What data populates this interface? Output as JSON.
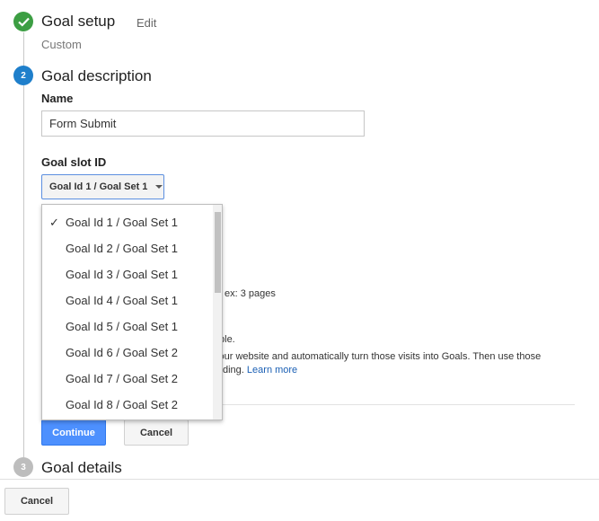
{
  "steps": {
    "setup": {
      "title": "Goal setup",
      "edit_label": "Edit",
      "summary": "Custom"
    },
    "description": {
      "number": "2",
      "title": "Goal description"
    },
    "details": {
      "number": "3",
      "title": "Goal details"
    }
  },
  "form": {
    "name_label": "Name",
    "name_value": "Form Submit",
    "goal_slot_label": "Goal slot ID",
    "goal_slot_selected": "Goal Id 1 / Goal Set 1"
  },
  "dropdown": {
    "check_glyph": "✓",
    "items": [
      {
        "label": "Goal Id 1 / Goal Set 1"
      },
      {
        "label": "Goal Id 2 / Goal Set 1"
      },
      {
        "label": "Goal Id 3 / Goal Set 1"
      },
      {
        "label": "Goal Id 4 / Goal Set 1"
      },
      {
        "label": "Goal Id 5 / Goal Set 1"
      },
      {
        "label": "Goal Id 6 / Goal Set 2"
      },
      {
        "label": "Goal Id 7 / Goal Set 2"
      },
      {
        "label": "Goal Id 8 / Goal Set 2"
      }
    ]
  },
  "partially_hidden": {
    "pages_hint": "ex: 3 pages",
    "available_text": "ilable.",
    "smart_line1": "your website and automatically turn those visits into Goals. Then use those",
    "smart_line2": "ding.",
    "learn_more": "Learn more"
  },
  "buttons": {
    "continue": "Continue",
    "cancel_inner": "Cancel",
    "cancel_bottom": "Cancel"
  },
  "colors": {
    "success_green": "#3c9e43",
    "active_blue": "#1f7fcb",
    "inactive_gray": "#bdbdbd",
    "primary_button": "#4d90fe",
    "link": "#1a5fb4"
  }
}
